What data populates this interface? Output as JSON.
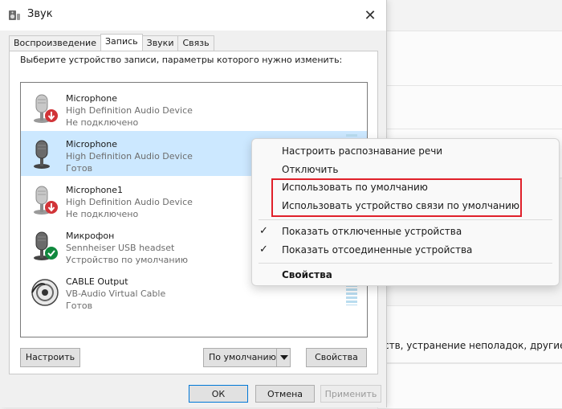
{
  "window": {
    "title": "Звук",
    "close_label": "✕"
  },
  "tabs": [
    {
      "label": "Воспроизведение",
      "active": false
    },
    {
      "label": "Запись",
      "active": true
    },
    {
      "label": "Звуки",
      "active": false
    },
    {
      "label": "Связь",
      "active": false
    }
  ],
  "instruction": "Выберите устройство записи, параметры которого нужно изменить:",
  "devices": [
    {
      "name": "Microphone",
      "subtitle": "High Definition Audio Device",
      "status": "Не подключено",
      "badge": "red-down-arrow",
      "selected": false
    },
    {
      "name": "Microphone",
      "subtitle": "High Definition Audio Device",
      "status": "Готов",
      "badge": "none",
      "selected": true
    },
    {
      "name": "Microphone1",
      "subtitle": "High Definition Audio Device",
      "status": "Не подключено",
      "badge": "red-down-arrow",
      "selected": false
    },
    {
      "name": "Микрофон",
      "subtitle": "Sennheiser USB headset",
      "status": "Устройство по умолчанию",
      "badge": "green-check",
      "selected": false
    },
    {
      "name": "CABLE Output",
      "subtitle": "VB-Audio Virtual Cable",
      "status": "Готов",
      "badge": "none",
      "selected": false
    }
  ],
  "buttons": {
    "configure": "Настроить",
    "default_select": "По умолчанию",
    "properties": "Свойства",
    "ok": "ОК",
    "cancel": "Отмена",
    "apply": "Применить"
  },
  "context_menu": {
    "items": [
      {
        "label": "Настроить распознавание речи",
        "checked": false,
        "bold": false
      },
      {
        "label": "Отключить",
        "checked": false,
        "bold": false
      },
      {
        "label": "Использовать по умолчанию",
        "checked": false,
        "bold": false
      },
      {
        "label": "Использовать устройство связи по умолчанию",
        "checked": false,
        "bold": false
      },
      {
        "label": "Показать отключенные устройства",
        "checked": true,
        "bold": false
      },
      {
        "label": "Показать отсоединенные устройства",
        "checked": true,
        "bold": false
      },
      {
        "label": "Свойства",
        "checked": false,
        "bold": true
      }
    ],
    "highlight_color": "#e0202a"
  },
  "background": {
    "partial_text": "ств, устранение неполадок, другие п"
  },
  "colors": {
    "selection": "#cce8ff",
    "accent": "#0078d7",
    "check_badge": "#10893e",
    "down_badge": "#d13438"
  }
}
